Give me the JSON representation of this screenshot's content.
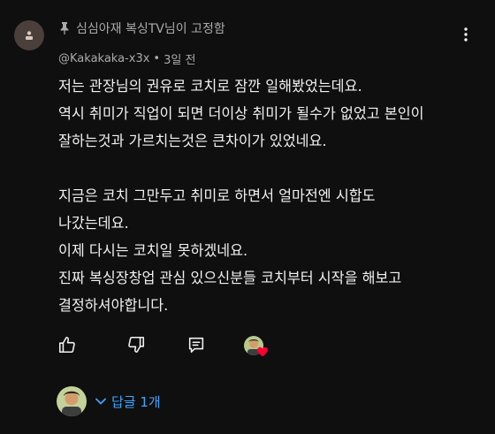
{
  "comment": {
    "pinned_label": "심심아재 복싱TV님이 고정함",
    "author": "@Kakakaka-x3x",
    "separator": "•",
    "time": "3일 전",
    "body_lines": [
      "저는 관장님의 권유로 코치로 잠깐 일해봤었는데요.",
      "역시 취미가 직업이 되면 더이상 취미가 될수가 없었고 본인이",
      "잘하는것과 가르치는것은 큰차이가 있었네요.",
      "",
      "지금은 코치 그만두고 취미로 하면서 얼마전엔 시합도",
      "나갔는데요.",
      "이제 다시는 코치일 못하겠네요.",
      "진짜 복싱장창업 관심 있으신분들 코치부터 시작을 해보고",
      "결정하셔야합니다."
    ]
  },
  "replies": {
    "label": "답글 1개"
  },
  "icons": {
    "pin": "pin-icon",
    "more": "more-vert-icon",
    "like": "thumb-up-icon",
    "dislike": "thumb-down-icon",
    "reply": "reply-comment-icon",
    "heart": "heart-icon",
    "chevron": "chevron-down-icon"
  },
  "colors": {
    "background": "#0f0f0f",
    "text": "#f1f1f1",
    "secondary_text": "#aaaaaa",
    "link_blue": "#3ea6ff",
    "heart_red": "#ff0033",
    "avatar_bg": "#4a3f3a"
  }
}
